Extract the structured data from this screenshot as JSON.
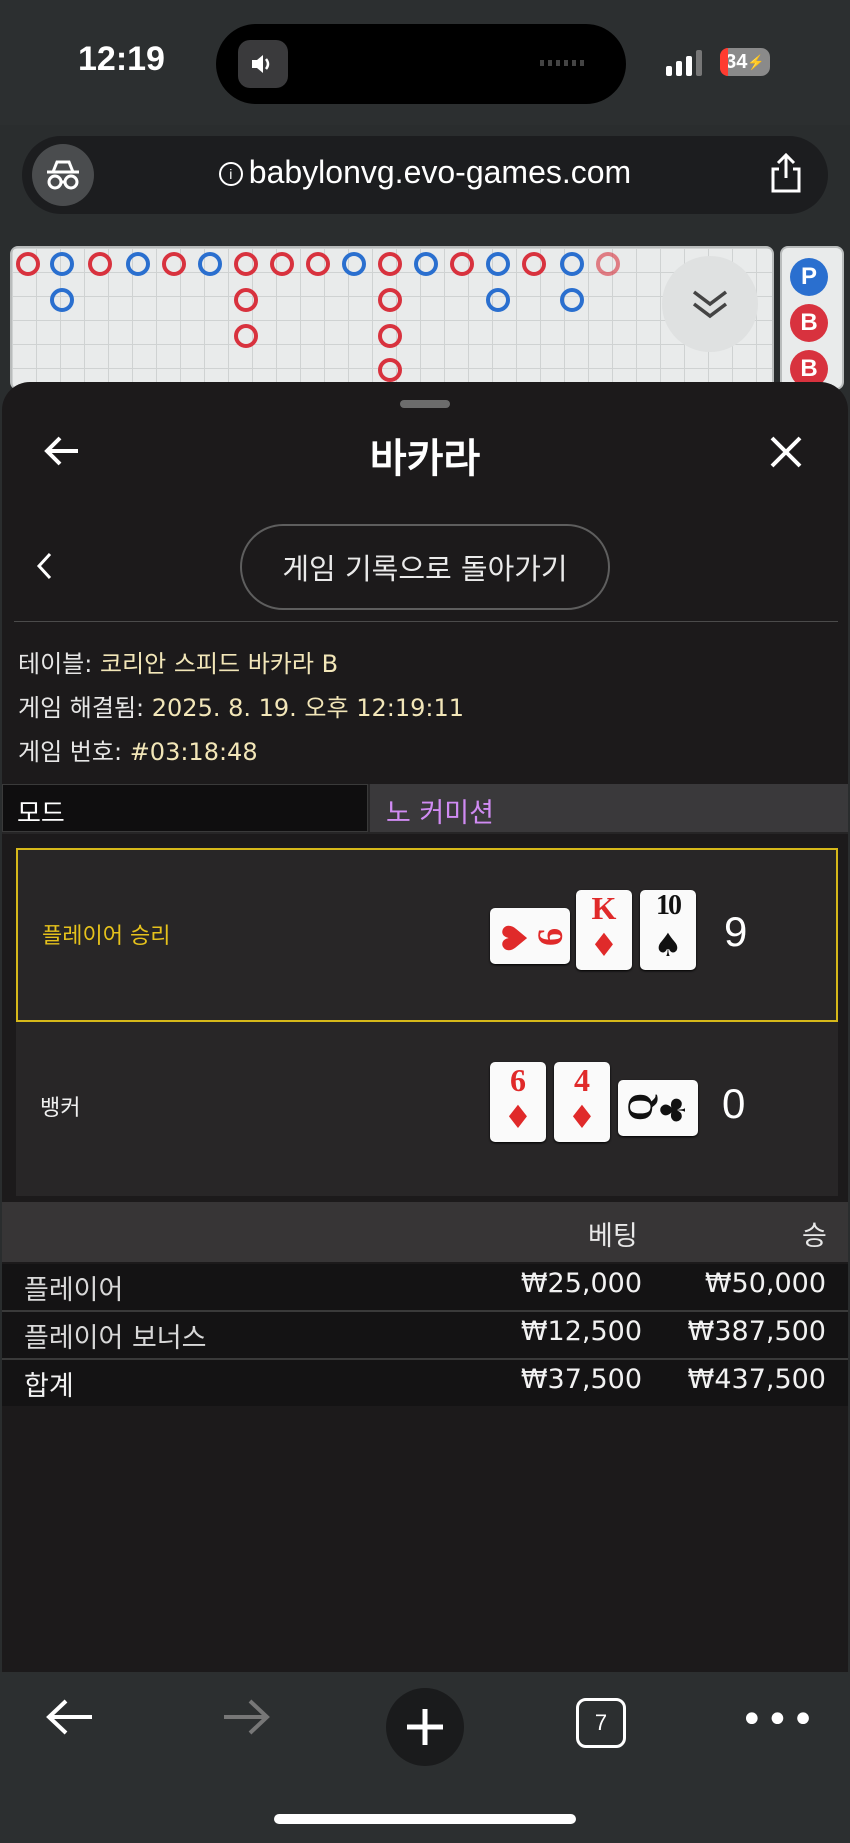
{
  "status": {
    "time": "12:19",
    "battery": "34"
  },
  "browser": {
    "url": "babylonvg.evo-games.com",
    "tab_count": "7"
  },
  "roadmap": {
    "badges": [
      "P",
      "B",
      "B"
    ]
  },
  "sheet": {
    "title": "바카라",
    "back_to_history": "게임 기록으로 돌아가기",
    "table_label": "테이블:",
    "table_value": "코리안 스피드 바카라 B",
    "resolved_label": "게임 해결됨:",
    "resolved_value": "2025. 8. 19. 오후 12:19:11",
    "round_label": "게임 번호:",
    "round_value": "#03:18:48",
    "mode_label": "모드",
    "mode_value": "노 커미션",
    "player": {
      "label": "플레이어 승리",
      "score": "9",
      "cards": [
        {
          "rank": "6",
          "suit": "♥",
          "color": "red",
          "rotated": true
        },
        {
          "rank": "K",
          "suit": "♦",
          "color": "red",
          "rotated": false
        },
        {
          "rank": "10",
          "suit": "♠",
          "color": "black",
          "rotated": false
        }
      ]
    },
    "banker": {
      "label": "뱅커",
      "score": "0",
      "cards": [
        {
          "rank": "6",
          "suit": "♦",
          "color": "red",
          "rotated": false
        },
        {
          "rank": "4",
          "suit": "♦",
          "color": "red",
          "rotated": false
        },
        {
          "rank": "Q",
          "suit": "♣",
          "color": "black",
          "rotated": true
        }
      ]
    },
    "bets": {
      "headers": {
        "bet": "베팅",
        "win": "승"
      },
      "rows": [
        {
          "name": "플레이어",
          "bet": "₩25,000",
          "win": "₩50,000"
        },
        {
          "name": "플레이어 보너스",
          "bet": "₩12,500",
          "win": "₩387,500"
        },
        {
          "name": "합계",
          "bet": "₩37,500",
          "win": "₩437,500"
        }
      ]
    }
  }
}
